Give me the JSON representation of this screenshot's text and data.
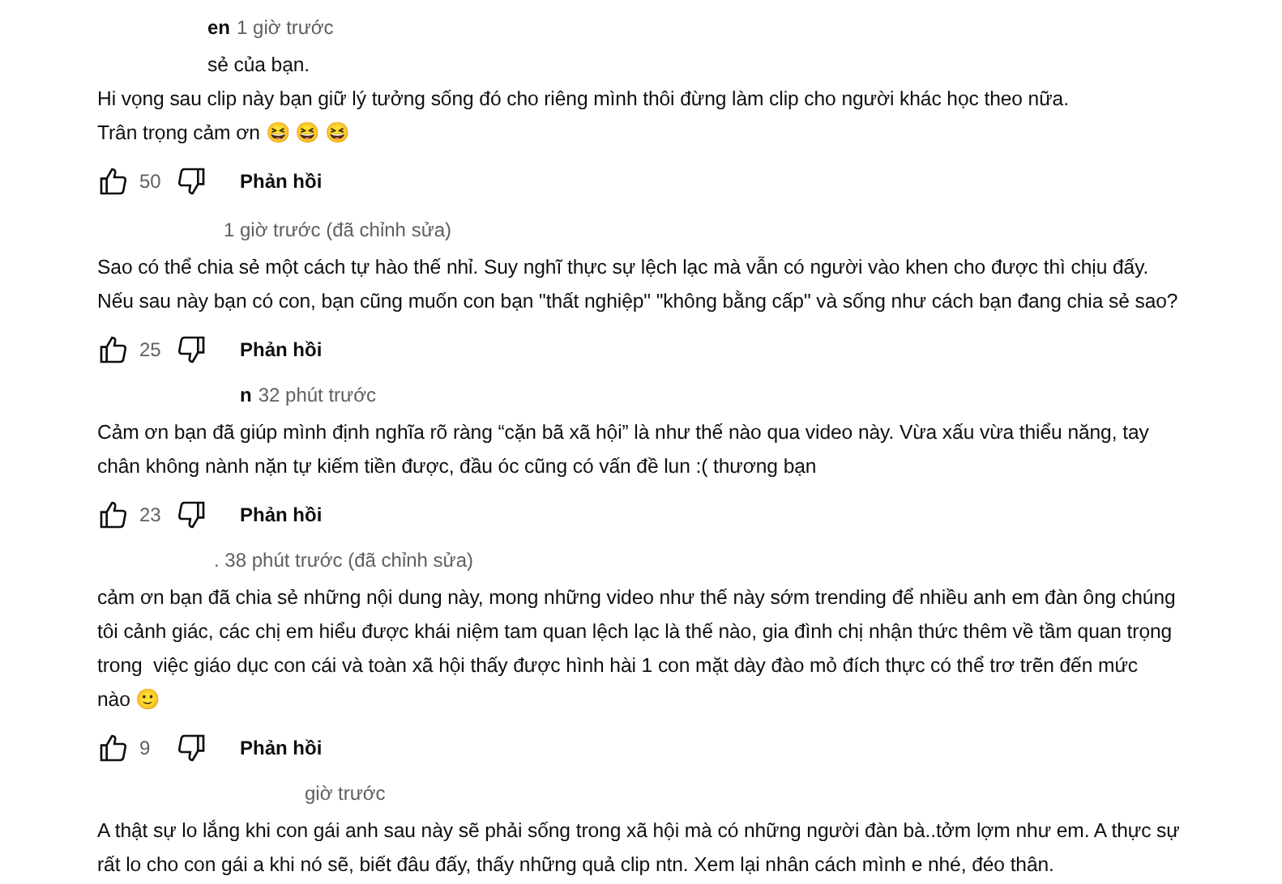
{
  "comments": [
    {
      "author": "en",
      "time": "1 giờ trước",
      "lines": [
        "sẻ của bạn.",
        "Hi vọng sau clip này bạn giữ lý tưởng sống đó cho riêng mình thôi đừng làm clip cho người khác học theo nữa.",
        "Trân trọng cảm ơn 😆 😆 😆"
      ],
      "likes": "50",
      "reply": "Phản hồi"
    },
    {
      "time": "1 giờ trước (đã chỉnh sửa)",
      "lines": [
        "Sao có thể chia sẻ một cách tự hào thế nhỉ. Suy nghĩ thực sự lệch lạc mà vẫn có người vào khen cho được thì chịu đấy.",
        "Nếu sau này bạn có con, bạn cũng muốn con bạn \"thất nghiệp\" \"không bằng cấp\" và sống như cách bạn đang chia sẻ sao?"
      ],
      "likes": "25",
      "reply": "Phản hồi"
    },
    {
      "author": "n",
      "time": "32 phút trước",
      "lines": [
        "Cảm ơn bạn đã giúp mình định nghĩa rõ ràng “cặn bã xã hội” là như thế nào qua video này. Vừa xấu vừa thiểu năng, tay",
        "chân không nành nặn tự kiếm tiền được, đầu óc cũng có vấn đề lun :( thương bạn"
      ],
      "likes": "23",
      "reply": "Phản hồi"
    },
    {
      "time": ". 38 phút trước (đã chỉnh sửa)",
      "lines": [
        "cảm ơn bạn đã chia sẻ những nội dung này, mong những video như thế này sớm trending để nhiều anh em đàn ông chúng",
        "tôi cảnh giác, các chị em hiểu được khái niệm tam quan lệch lạc là thế nào, gia đình chị nhận thức thêm về tầm quan trọng",
        "trong  việc giáo dục con cái và toàn xã hội thấy được hình hài 1 con mặt dày đào mỏ đích thực có thể trơ trẽn đến mức",
        "nào 🙂"
      ],
      "likes": "9",
      "reply": "Phản hồi"
    },
    {
      "time": "giờ trước",
      "lines": [
        "A thật sự lo lắng khi con gái anh sau này sẽ phải sống trong xã hội mà có những người đàn bà..tởm lợm như em. A thực sự",
        "rất lo cho con gái a khi nó sẽ, biết đâu đấy, thấy những quả clip ntn. Xem lại nhân cách mình e nhé, đéo thân."
      ]
    }
  ]
}
